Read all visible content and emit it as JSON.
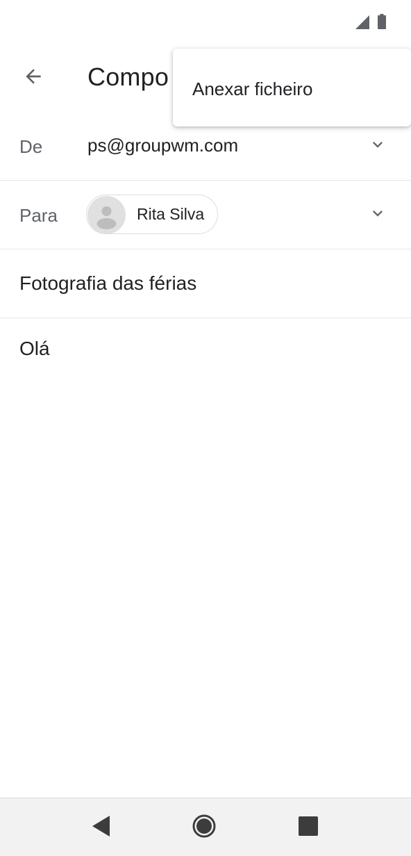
{
  "status_bar": {
    "signal_icon": "signal-icon",
    "battery_icon": "battery-icon"
  },
  "app_bar": {
    "back_icon": "arrow-back-icon",
    "title": "Compo"
  },
  "from": {
    "label": "De",
    "value": "ps@groupwm.com",
    "expand_icon": "chevron-down-icon"
  },
  "to": {
    "label": "Para",
    "recipient": "Rita Silva",
    "avatar_icon": "person-icon",
    "expand_icon": "chevron-down-icon"
  },
  "subject": {
    "value": "Fotografia das férias"
  },
  "body": {
    "value": "Olá"
  },
  "menu": {
    "items": [
      {
        "label": "Anexar ficheiro"
      }
    ]
  },
  "nav_bar": {
    "back_icon": "nav-back-icon",
    "home_icon": "nav-home-icon",
    "recents_icon": "nav-recents-icon"
  },
  "colors": {
    "text": "#202124",
    "secondary_text": "#5f6368",
    "divider": "#e6e6e6",
    "nav_background": "#f2f2f2"
  }
}
